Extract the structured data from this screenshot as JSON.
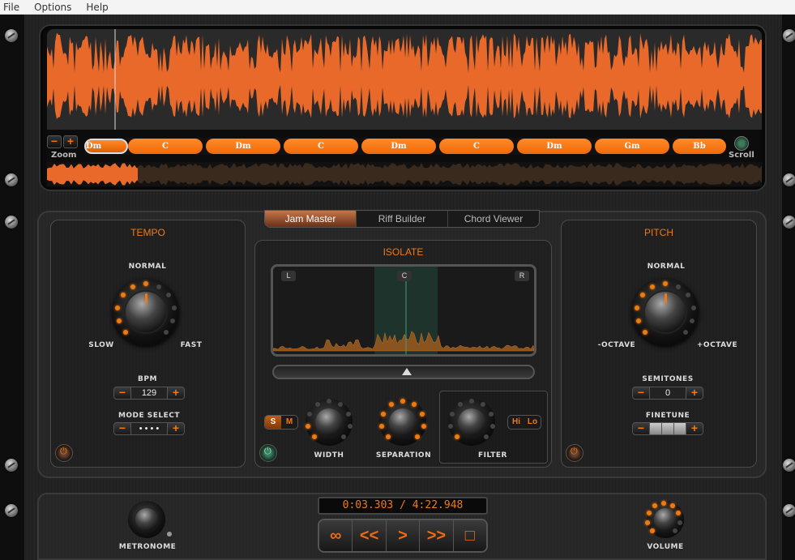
{
  "menu": [
    "File",
    "Options",
    "Help"
  ],
  "chords": [
    "Dm",
    "C",
    "Dm",
    "C",
    "Dm",
    "C",
    "Dm",
    "Gm",
    "Bb"
  ],
  "waveform": {
    "zoom_label": "Zoom",
    "scroll_label": "Scroll",
    "minus": "−",
    "plus": "+"
  },
  "tabs": [
    "Jam Master",
    "Riff Builder",
    "Chord Viewer"
  ],
  "tempo": {
    "title": "TEMPO",
    "normal": "NORMAL",
    "slow": "SLOW",
    "fast": "FAST",
    "bpm_label": "BPM",
    "bpm_value": "129",
    "mode_label": "MODE SELECT",
    "mode_value": "• • • •"
  },
  "isolate": {
    "title": "ISOLATE",
    "left": "L",
    "center": "C",
    "right": "R",
    "solo": "S",
    "mute": "M",
    "width": "WIDTH",
    "separation": "SEPARATION",
    "filter": "FILTER",
    "hi": "Hi",
    "lo": "Lo"
  },
  "pitch": {
    "title": "PITCH",
    "normal": "NORMAL",
    "minus_octave": "-OCTAVE",
    "plus_octave": "+OCTAVE",
    "semitones_label": "SEMITONES",
    "semitones_value": "0",
    "finetune_label": "FINETUNE"
  },
  "transport": {
    "time": "0:03.303 / 4:22.948",
    "loop": "∞",
    "rewind": "<<",
    "play": ">",
    "forward": ">>",
    "stop": "□",
    "metronome": "METRONOME",
    "volume": "VOLUME"
  },
  "colors": {
    "accent": "#f07a10",
    "waveform": "#e8692a"
  }
}
